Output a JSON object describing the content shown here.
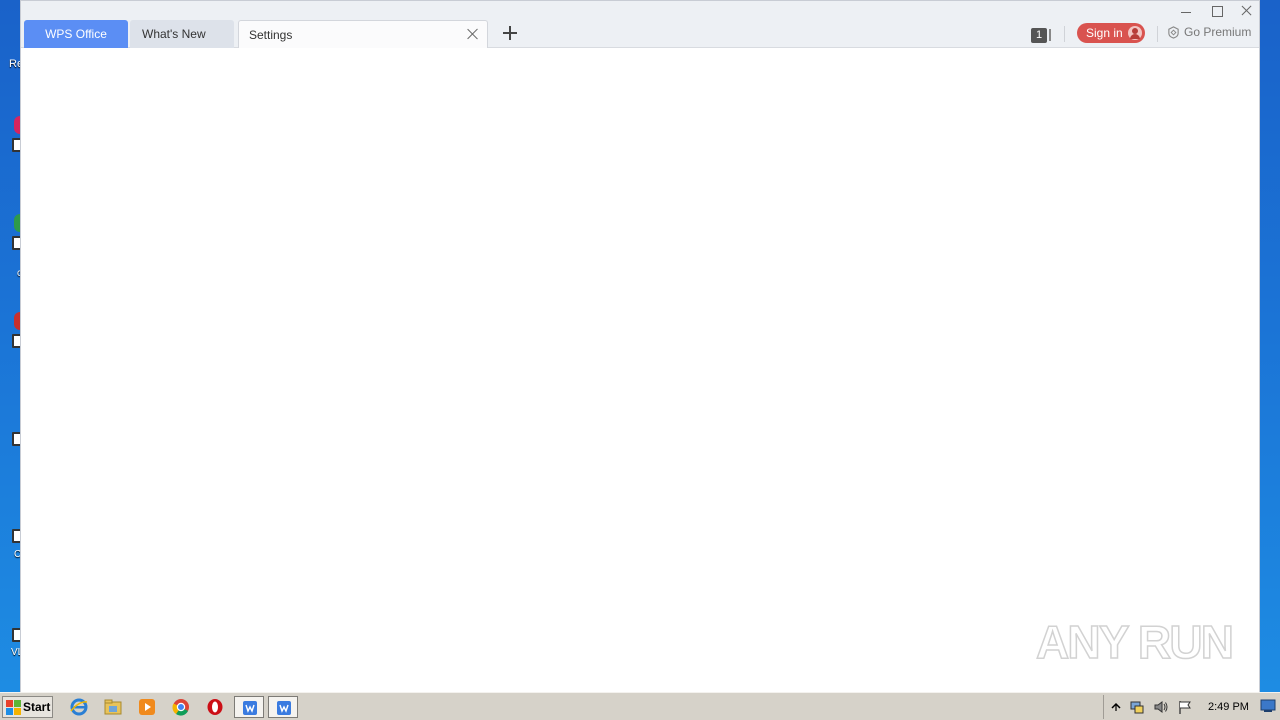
{
  "desktop": {
    "partial_label": "Re",
    "partial_texts": [
      "c",
      "C",
      "VL"
    ]
  },
  "window": {
    "tabs": [
      {
        "label": "WPS Office"
      },
      {
        "label": "What's New"
      },
      {
        "label": "Settings"
      }
    ],
    "notification_count": "1",
    "signin_label": "Sign in",
    "premium_label": "Go Premium"
  },
  "taskbar": {
    "start_label": "Start",
    "clock": "2:49 PM"
  },
  "watermark": {
    "text": "ANY RUN"
  },
  "colors": {
    "wps_tab": "#5b8ef4",
    "signin": "#d9534f",
    "desktop": "#1b74d6"
  }
}
